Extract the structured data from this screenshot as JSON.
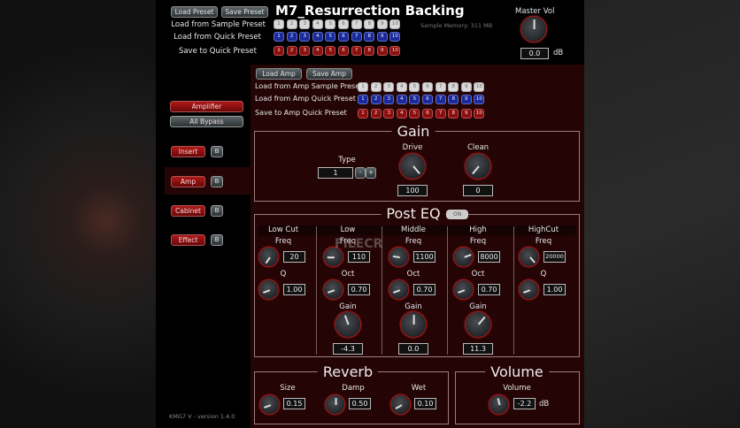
{
  "title": "M7_Resurrection Backing",
  "top": {
    "load_preset": "Load Preset",
    "save_preset": "Save Preset",
    "sample_label": "Load from Sample Preset",
    "quick_label": "Load from Quick Preset",
    "save_quick_label": "Save to Quick Preset",
    "sample_memory": "Sample Memory: 311 MB",
    "numbers": [
      "1",
      "2",
      "3",
      "4",
      "5",
      "6",
      "7",
      "8",
      "9",
      "10"
    ]
  },
  "master": {
    "label": "Master Vol",
    "value": "0.0",
    "unit": "dB"
  },
  "amp": {
    "load_amp": "Load Amp",
    "save_amp": "Save Amp",
    "sample_label": "Load from Amp Sample Preset",
    "quick_label": "Load from Amp Quick Preset",
    "save_quick_label": "Save to Amp Quick Preset"
  },
  "sidebar": {
    "amplifier": "Amplifier",
    "all_bypass": "All Bypass",
    "bypass": "B",
    "items": [
      {
        "label": "Insert"
      },
      {
        "label": "Amp"
      },
      {
        "label": "Cabinet"
      },
      {
        "label": "Effect"
      }
    ],
    "version": "KMG7 V - version 1.4.0"
  },
  "gain": {
    "title": "Gain",
    "type_label": "Type",
    "type_value": "1",
    "minus": "-",
    "plus": "+",
    "drive_label": "Drive",
    "drive_value": "100",
    "clean_label": "Clean",
    "clean_value": "0"
  },
  "eq": {
    "title": "Post EQ",
    "toggle": "ON",
    "columns": [
      {
        "name": "Low Cut",
        "freq_label": "Freq",
        "freq": "20",
        "q_label": "Q",
        "q": "1.00"
      },
      {
        "name": "Low",
        "freq_label": "Freq",
        "freq": "110",
        "q_label": "Oct",
        "q": "0.70",
        "gain_label": "Gain",
        "gain": "-4.3"
      },
      {
        "name": "Middle",
        "freq_label": "Freq",
        "freq": "1100",
        "q_label": "Oct",
        "q": "0.70",
        "gain_label": "Gain",
        "gain": "0.0"
      },
      {
        "name": "High",
        "freq_label": "Freq",
        "freq": "8000",
        "q_label": "Oct",
        "q": "0.70",
        "gain_label": "Gain",
        "gain": "11.3"
      },
      {
        "name": "HighCut",
        "freq_label": "Freq",
        "freq": "20000",
        "q_label": "Q",
        "q": "1.00"
      }
    ]
  },
  "reverb": {
    "title": "Reverb",
    "size_label": "Size",
    "size": "0.15",
    "damp_label": "Damp",
    "damp": "0.50",
    "wet_label": "Wet",
    "wet": "0.10"
  },
  "volume": {
    "title": "Volume",
    "label": "Volume",
    "value": "-2.2",
    "unit": "dB"
  },
  "watermark": "FILECR"
}
